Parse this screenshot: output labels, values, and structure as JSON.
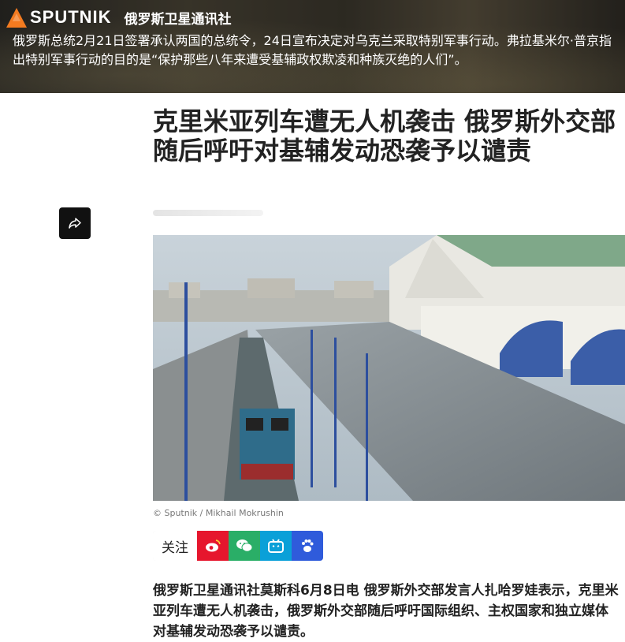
{
  "header": {
    "logo_text": "SPUTNIK",
    "logo_sub": "俄罗斯卫星通讯社",
    "banner_text": "俄罗斯总统2月21日签署承认两国的总统令，24日宣布决定对乌克兰采取特别军事行动。弗拉基米尔·普京指出特别军事行动的目的是“保护那些八年来遭受基辅政权欺凌和种族灭绝的人们”。"
  },
  "article": {
    "title": "克里米亚列车遭无人机袭击 俄罗斯外交部随后呼吁对基辅发动恐袭予以谴责",
    "photo_credit": "© Sputnik / Mikhail Mokrushin",
    "lead": "俄罗斯卫星通讯社莫斯科6月8日电 俄罗斯外交部发言人扎哈罗娃表示，克里米亚列车遭无人机袭击，俄罗斯外交部随后呼吁国际组织、主权国家和独立媒体对基辅发动恐袭予以谴责。"
  },
  "social": {
    "follow_label": "关注",
    "icons": [
      "weibo-icon",
      "wechat-icon",
      "bilibili-icon",
      "baidu-icon"
    ]
  },
  "colors": {
    "accent_orange": "#f47b20",
    "weibo": "#e6162d",
    "wechat": "#2aae67",
    "bilibili": "#0aa0d8",
    "baidu": "#2f5bdb"
  }
}
